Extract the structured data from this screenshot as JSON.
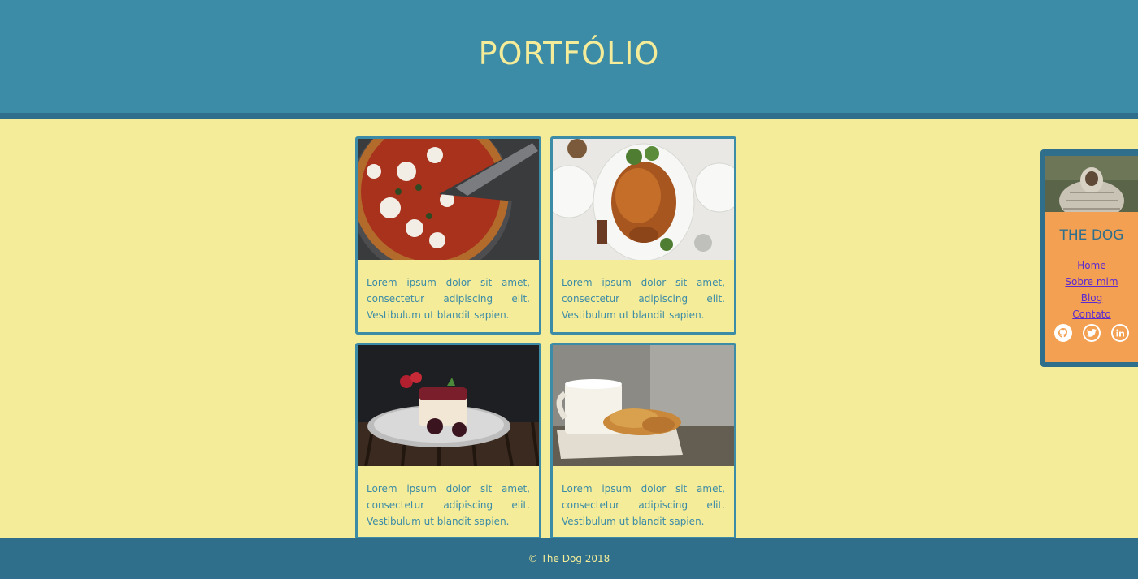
{
  "header": {
    "title": "PORTFÓLIO"
  },
  "cards": [
    {
      "image": "pizza-photo",
      "text": "Lorem ipsum dolor sit amet, consectetur adipiscing elit. Vestibulum ut blandit sapien."
    },
    {
      "image": "roast-turkey-photo",
      "text": "Lorem ipsum dolor sit amet, consectetur adipiscing elit. Vestibulum ut blandit sapien."
    },
    {
      "image": "cake-photo",
      "text": "Lorem ipsum dolor sit amet, consectetur adipiscing elit. Vestibulum ut blandit sapien."
    },
    {
      "image": "croissant-coffee-photo",
      "text": "Lorem ipsum dolor sit amet, consectetur adipiscing elit. Vestibulum ut blandit sapien."
    }
  ],
  "profile": {
    "avatar": "dog-in-blanket-photo",
    "name": "THE DOG",
    "nav": [
      "Home",
      "Sobre mim",
      "Blog",
      "Contato"
    ],
    "social": [
      "github-icon",
      "twitter-icon",
      "linkedin-icon"
    ]
  },
  "footer": {
    "text": "© The Dog 2018"
  },
  "colors": {
    "header_bg": "#3c8ba7",
    "header_border": "#2f6f8b",
    "page_bg": "#f4ec98",
    "title_text": "#f4ec98",
    "card_border": "#3c8ba7",
    "profile_bg": "#f3a052",
    "link": "#5b2bd1"
  }
}
